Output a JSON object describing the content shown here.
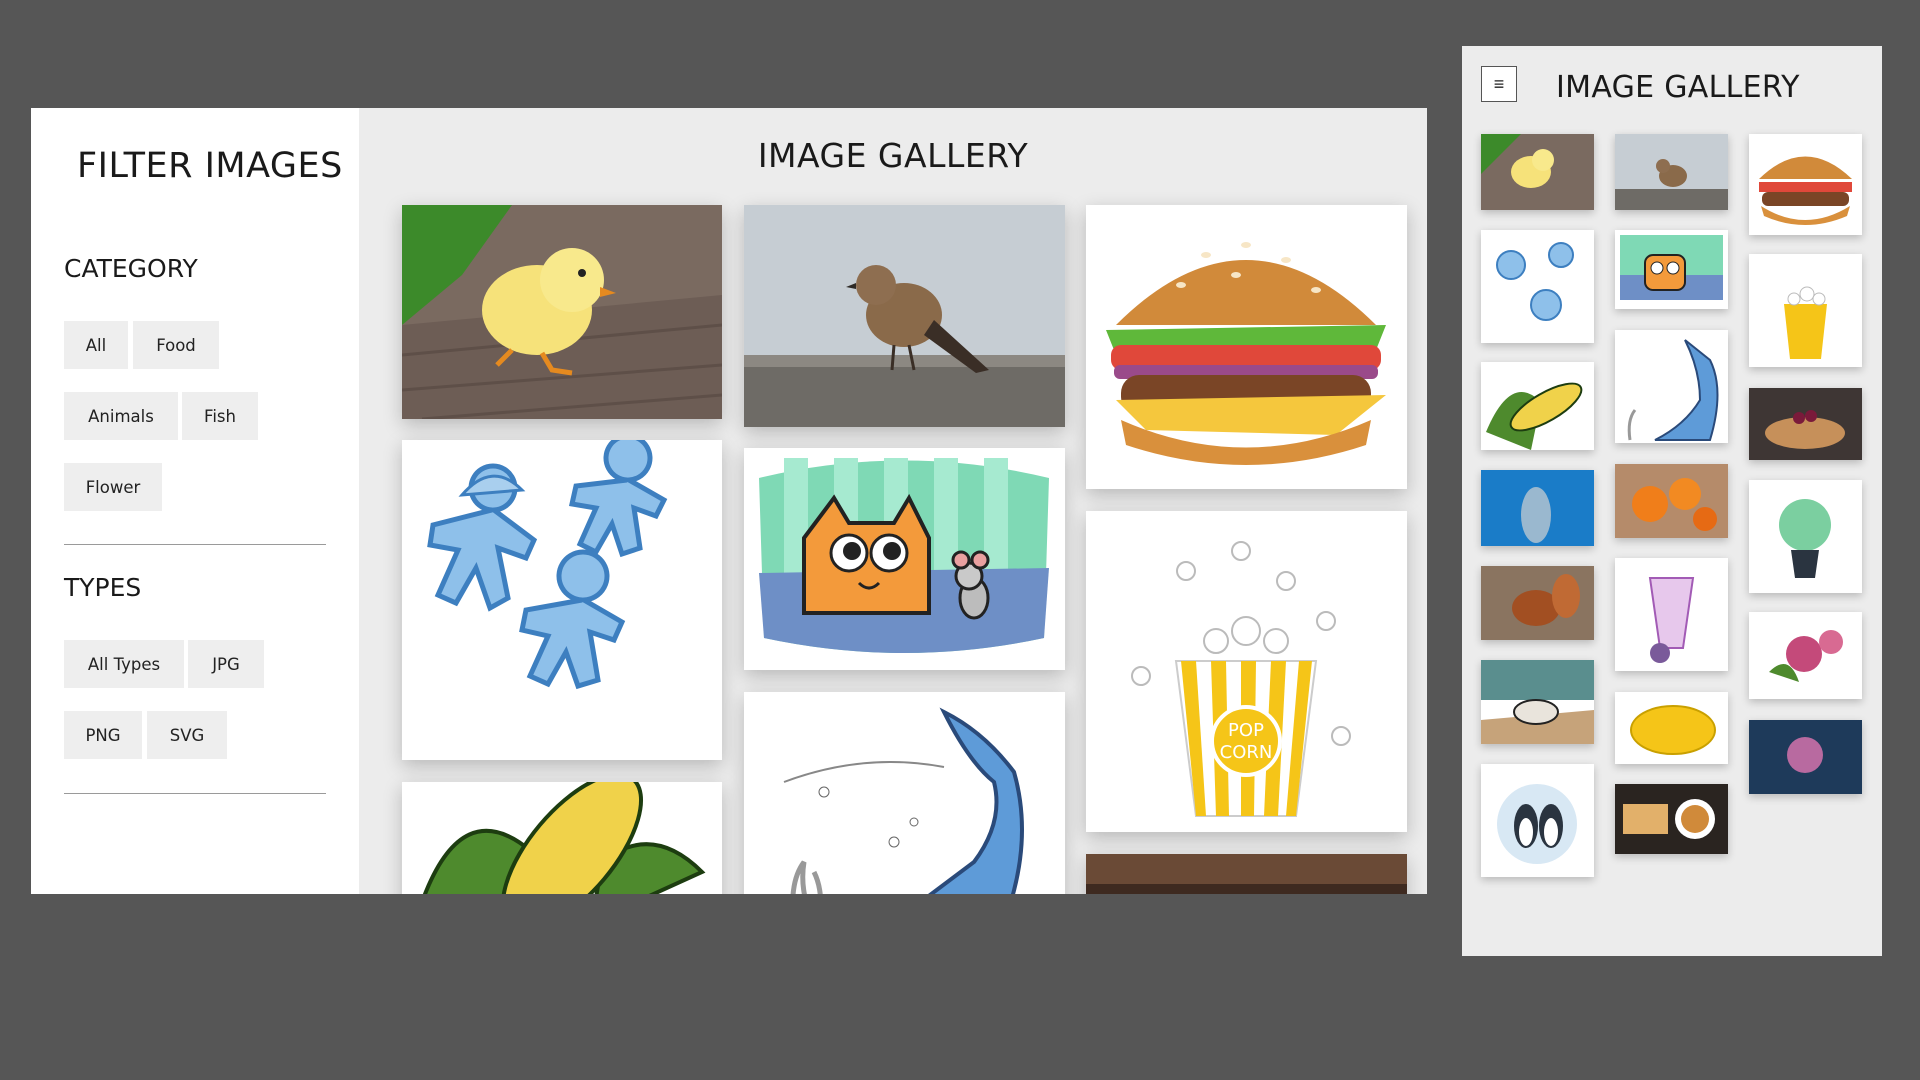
{
  "desktop": {
    "sidebar_title": "FILTER IMAGES",
    "category": {
      "heading": "CATEGORY",
      "buttons": [
        "All",
        "Food",
        "Animals",
        "Fish",
        "Flower"
      ]
    },
    "types": {
      "heading": "TYPES",
      "buttons": [
        "All Types",
        "JPG",
        "PNG",
        "SVG"
      ]
    },
    "gallery_title": "IMAGE GALLERY",
    "gallery_images": [
      "chick",
      "sparrow",
      "burger",
      "gingerbread-men",
      "cat-and-mouse",
      "popcorn",
      "corn",
      "dolphin",
      "food-table"
    ]
  },
  "mobile": {
    "menu_icon": "≡",
    "title": "IMAGE GALLERY",
    "gallery_images": [
      "chick",
      "sparrow",
      "burger",
      "gingerbread-men",
      "cat-and-mouse",
      "popcorn",
      "corn",
      "dolphin",
      "pancakes",
      "dolphin-photo",
      "oranges",
      "flower-pot",
      "squirrel",
      "drink",
      "roses",
      "hamster",
      "chicken",
      "rose",
      "penguins",
      "tea-cake"
    ]
  },
  "colors": {
    "background": "#565656",
    "panel": "#ececec",
    "button": "#eeeeee"
  }
}
